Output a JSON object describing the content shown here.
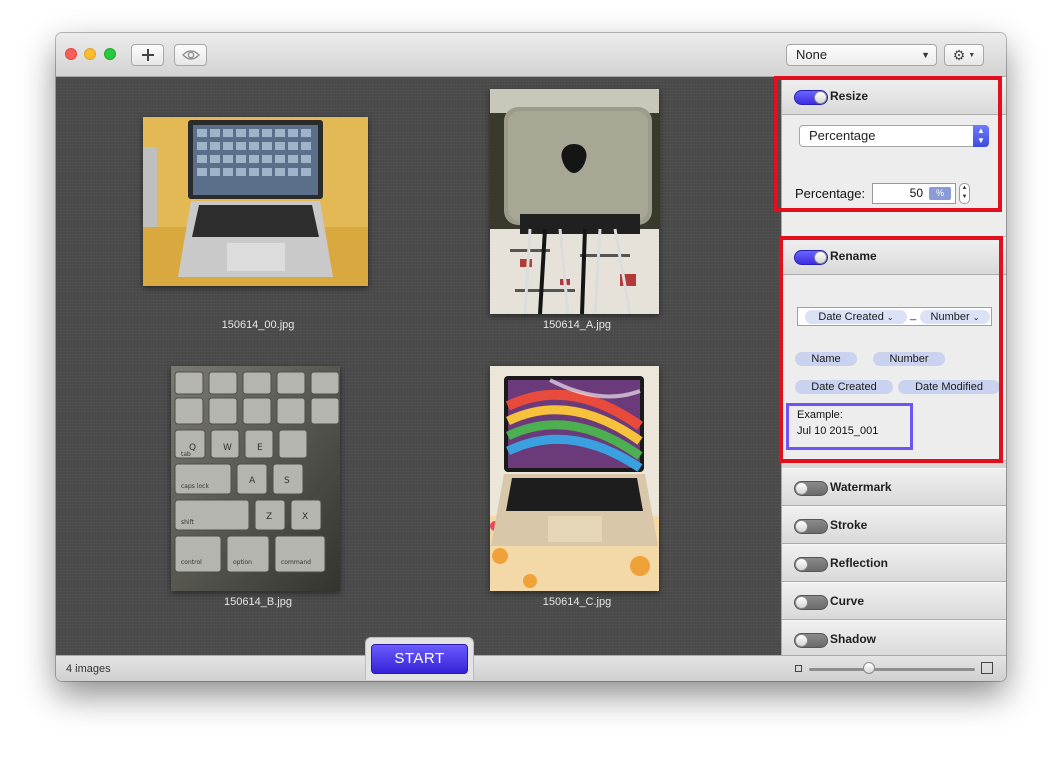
{
  "toolbar": {
    "preset_value": "None",
    "add_icon": "plus-icon",
    "preview_icon": "eye-icon",
    "settings_icon": "gear-icon"
  },
  "images": [
    {
      "filename": "150614_00.jpg"
    },
    {
      "filename": "150614_A.jpg"
    },
    {
      "filename": "150614_B.jpg"
    },
    {
      "filename": "150614_C.jpg"
    }
  ],
  "status": {
    "count": "4 images",
    "start_label": "START"
  },
  "sidebar": {
    "resize": {
      "title": "Resize",
      "enabled": true,
      "mode": "Percentage",
      "percentage_label": "Percentage:",
      "percentage_value": "50",
      "unit": "%"
    },
    "rename": {
      "title": "Rename",
      "enabled": true,
      "pattern_tokens": [
        "Date Created",
        "Number"
      ],
      "pattern_separator": "_",
      "available_tokens": [
        "Name",
        "Number",
        "Date Created",
        "Date Modified"
      ],
      "example_label": "Example:",
      "example_value": "Jul 10 2015_001"
    },
    "sections": [
      {
        "title": "Watermark",
        "enabled": false
      },
      {
        "title": "Stroke",
        "enabled": false
      },
      {
        "title": "Reflection",
        "enabled": false
      },
      {
        "title": "Curve",
        "enabled": false
      },
      {
        "title": "Shadow",
        "enabled": false
      }
    ]
  },
  "colors": {
    "accent": "#3a2de0",
    "highlight_red": "#e2101c",
    "highlight_blue": "#6d55f5"
  }
}
